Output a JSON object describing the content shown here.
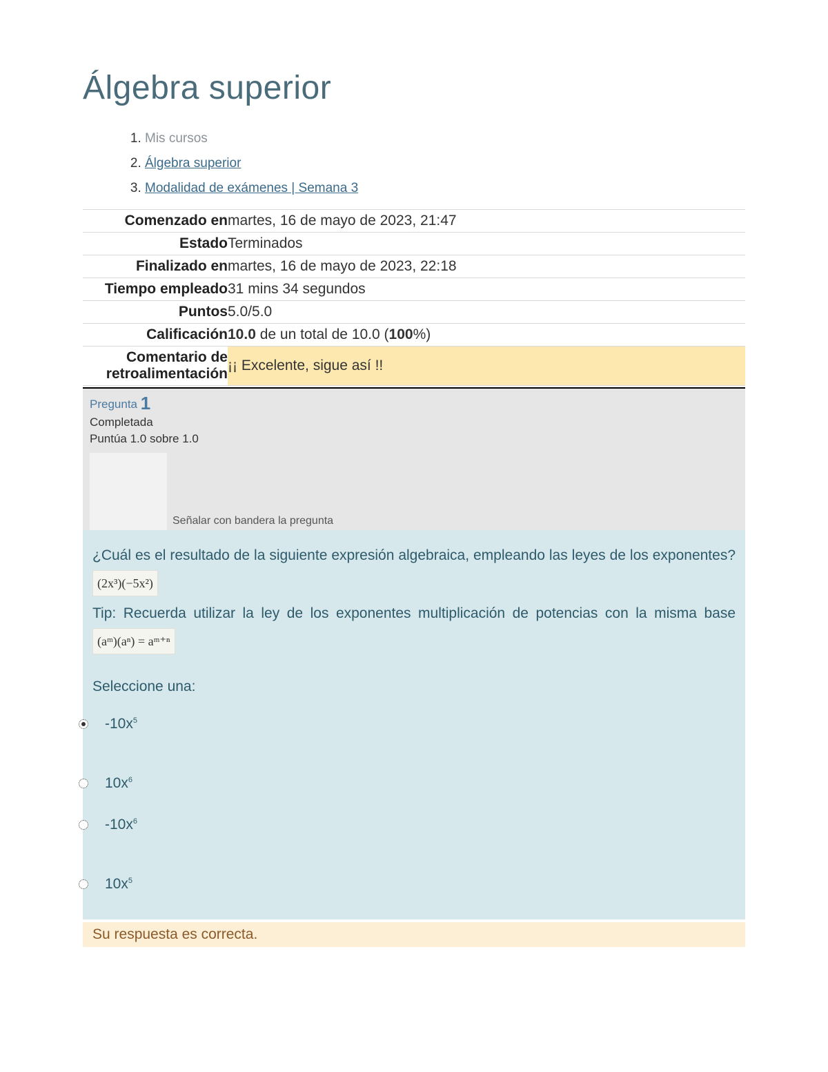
{
  "title": "Álgebra superior",
  "breadcrumb": [
    {
      "label": "Mis cursos",
      "link": false
    },
    {
      "label": "Álgebra superior",
      "link": true
    },
    {
      "label": "Modalidad de exámenes | Semana 3",
      "link": true
    }
  ],
  "summary": {
    "started_label": "Comenzado en",
    "started_value": "martes, 16 de mayo de 2023, 21:47",
    "state_label": "Estado",
    "state_value": "Terminados",
    "finished_label": "Finalizado en",
    "finished_value": "martes, 16 de mayo de 2023, 22:18",
    "time_label": "Tiempo empleado",
    "time_value": "31 mins 34 segundos",
    "points_label": "Puntos",
    "points_value": "5.0/5.0",
    "grade_label": "Calificación",
    "grade_num": "10.0",
    "grade_rest": " de un total de 10.0 (",
    "grade_pct": "100",
    "grade_close": "%)",
    "feedback_label": "Comentario de retroalimentación",
    "feedback_value": "¡¡ Excelente, sigue así !!"
  },
  "question": {
    "label_prefix": "Pregunta ",
    "number": "1",
    "status": "Completada",
    "score": "Puntúa 1.0 sobre 1.0",
    "flag_text": "Señalar con bandera la pregunta",
    "text_1": "¿Cuál es el resultado de la siguiente expresión algebraica, empleando las leyes de los exponentes?",
    "math_1": "(2x³)(−5x²)",
    "tip_prefix": "Tip: ",
    "tip_body": "Recuerda utilizar la ley de los exponentes multiplicación de potencias con la misma base ",
    "math_2": "(aᵐ)(aⁿ) = aᵐ⁺ⁿ",
    "select_label": "Seleccione una:",
    "options": [
      {
        "text": "-10x",
        "sup": "5",
        "selected": true,
        "gap": true
      },
      {
        "text": "10x",
        "sup": "6",
        "selected": false,
        "gap": false
      },
      {
        "text": "-10x",
        "sup": "6",
        "selected": false,
        "gap": true
      },
      {
        "text": "10x",
        "sup": "5",
        "selected": false,
        "gap": false
      }
    ],
    "correct_text": "Su respuesta es correcta."
  }
}
